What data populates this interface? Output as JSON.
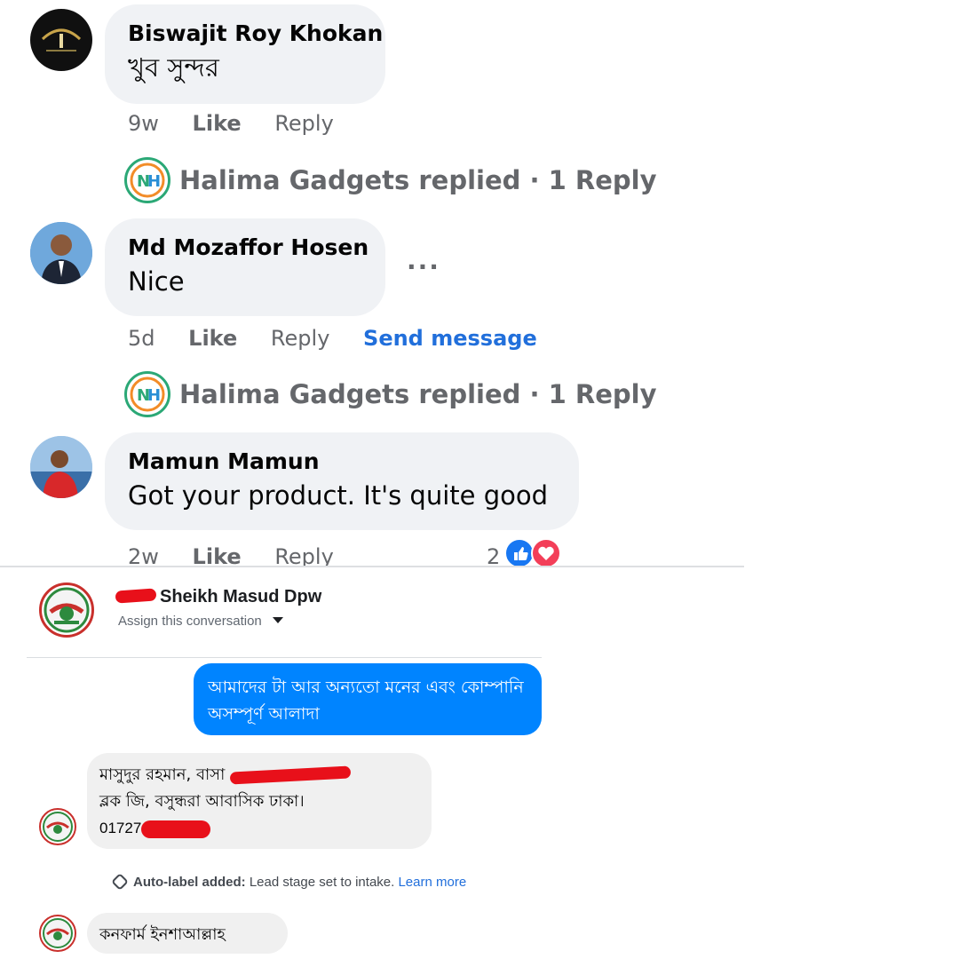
{
  "comments": [
    {
      "author": "Biswajit Roy Khokan",
      "text": "খুব সুন্দর",
      "time": "9w",
      "like": "Like",
      "reply": "Reply",
      "replies_summary": "Halima Gadgets replied · 1 Reply"
    },
    {
      "author": "Md Mozaffor Hosen",
      "text": "Nice",
      "time": "5d",
      "like": "Like",
      "reply": "Reply",
      "send_message": "Send message",
      "more": "···",
      "replies_summary": "Halima Gadgets replied · 1 Reply"
    },
    {
      "author": "Mamun Mamun",
      "text": "Got your product. It's quite good",
      "time": "2w",
      "like": "Like",
      "reply": "Reply",
      "reaction_count": "2"
    }
  ],
  "reactions": {
    "like_color": "#1877f2",
    "love_color": "#f33e58"
  },
  "messenger": {
    "contact_name": "Sheikh Masud Dpw",
    "assign_label": "Assign this conversation",
    "outgoing": "আমাদের টা আর অন্যতো মনের এবং কোম্পানি অসম্পূর্ণ আলাদা",
    "incoming_address_line1": "মাসুদুর রহমান, বাসা",
    "incoming_address_line2": "ব্লক জি, বসুন্ধরা আবাসিক ঢাকা।",
    "incoming_phone": "01727",
    "auto_label_prefix": "Auto-label added:",
    "auto_label_text": "Lead stage set to intake.",
    "learn_more": "Learn more",
    "last_message": "কনফার্ম ইনশাআল্লাহ"
  },
  "colors": {
    "bubble_bg": "#f0f2f5",
    "meta": "#65676b",
    "link": "#216fdb",
    "outgoing_bubble": "#0084ff",
    "redaction": "#e8101a"
  }
}
